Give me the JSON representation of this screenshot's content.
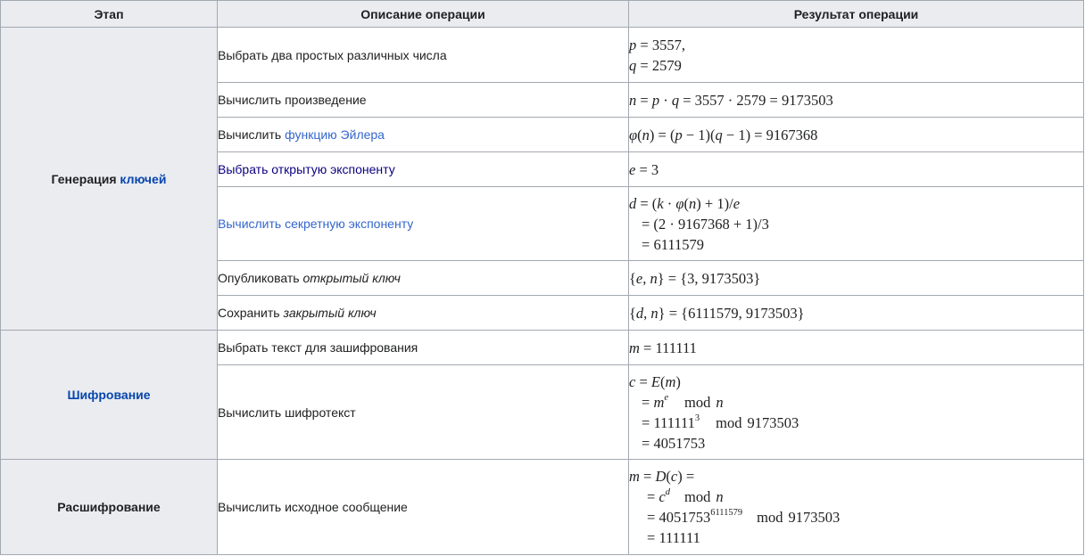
{
  "headers": {
    "stage": "Этап",
    "description": "Описание операции",
    "result": "Результат операции"
  },
  "stages": {
    "keygen_prefix": "Генерация ",
    "keygen_link": "ключей",
    "encryption": "Шифрование",
    "decryption": "Расшифрование"
  },
  "descriptions": {
    "choose_primes": "Выбрать два простых различных числа",
    "compute_product": "Вычислить произведение",
    "euler_prefix": "Вычислить ",
    "euler_link": "функцию Эйлера",
    "public_exponent_link": "Выбрать открытую экспоненту",
    "secret_exponent_link": "Вычислить секретную экспоненту",
    "publish_prefix": "Опубликовать ",
    "publish_italic": "открытый ключ",
    "save_prefix": "Сохранить ",
    "save_italic": "закрытый ключ",
    "choose_text": "Выбрать текст для зашифрования",
    "compute_ciphertext": "Вычислить шифротекст",
    "compute_original": "Вычислить исходное сообщение"
  },
  "values": {
    "p": "3557",
    "q": "2579",
    "n": "9173503",
    "phi": "9167368",
    "e": "3",
    "two": "2",
    "d": "6111579",
    "m": "111111",
    "c": "4051753",
    "one": "1",
    "mod": "mod"
  }
}
